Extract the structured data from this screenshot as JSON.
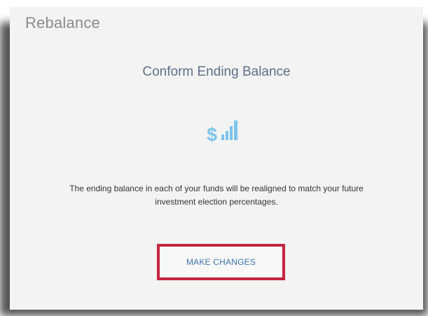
{
  "panel": {
    "title": "Rebalance",
    "heading": "Conform Ending Balance",
    "icon": "dollar-bar-chart-icon",
    "description_line1": "The ending balance in each of your funds will be realigned to match your future",
    "description_line2": "investment election percentages.",
    "button_label": "MAKE CHANGES"
  },
  "colors": {
    "card_background": "#f3f3f3",
    "title_text": "#8a8a8a",
    "heading_text": "#5f6f86",
    "icon": "#7cc4ee",
    "button_text": "#3a75ad",
    "highlight_border": "#c3253f"
  }
}
